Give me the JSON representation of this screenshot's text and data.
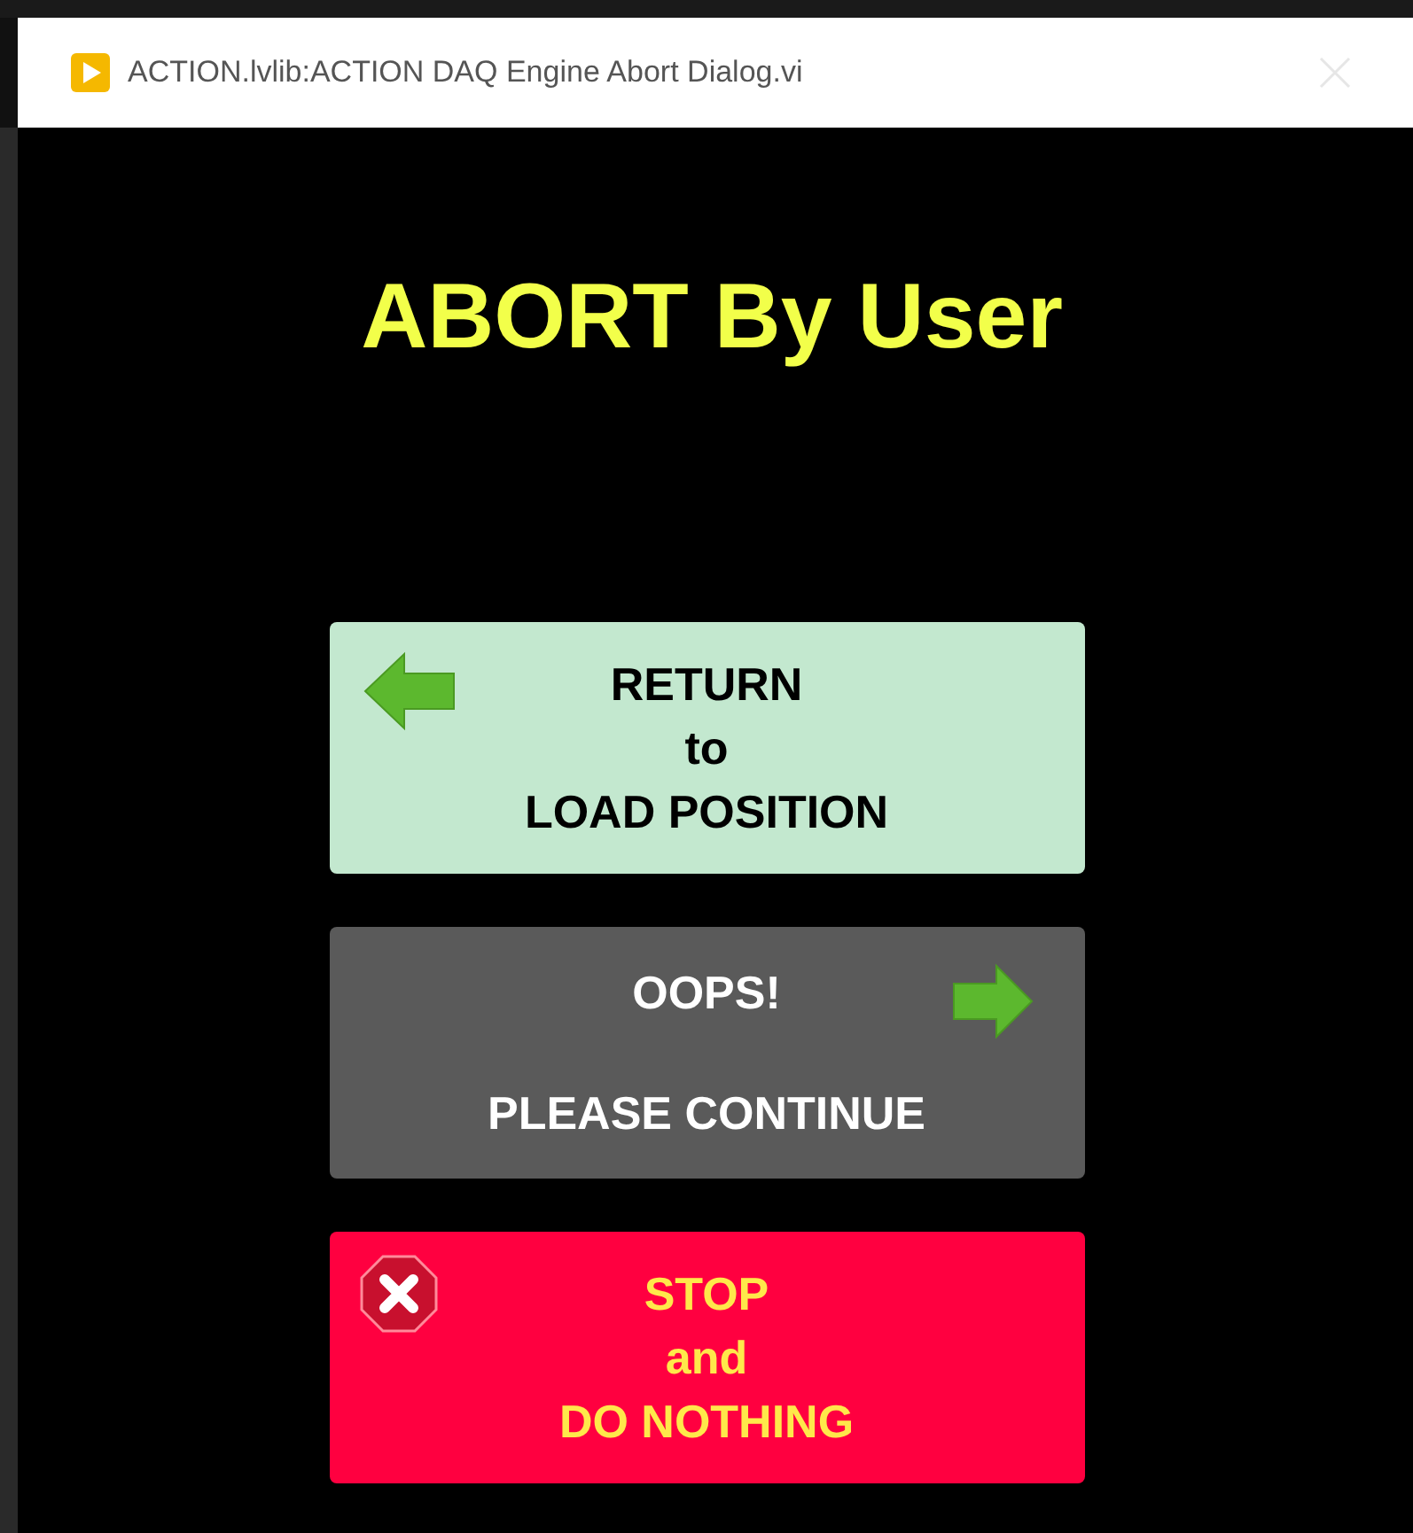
{
  "window": {
    "title": "ACTION.lvlib:ACTION DAQ Engine Abort Dialog.vi"
  },
  "heading": "ABORT By User",
  "buttons": [
    {
      "kind": "return",
      "lines": [
        "RETURN",
        "to",
        "LOAD POSITION"
      ]
    },
    {
      "kind": "continue",
      "lines": [
        "OOPS!",
        "PLEASE CONTINUE"
      ]
    },
    {
      "kind": "stop",
      "lines": [
        "STOP",
        "and",
        "DO NOTHING"
      ]
    }
  ]
}
